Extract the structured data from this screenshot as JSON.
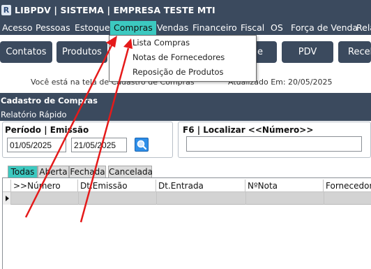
{
  "window": {
    "logo_letter": "R",
    "title": "LIBPDV | SISTEMA | EMPRESA TESTE MTI"
  },
  "menubar": {
    "items": [
      "Acesso",
      "Pessoas",
      "Estoque",
      "Compras",
      "Vendas",
      "Financeiro",
      "Fiscal",
      "OS",
      "Força de Venda",
      "Rela"
    ],
    "active": "Compras"
  },
  "dropdown": {
    "items": [
      "Lista Compras",
      "Notas de Fornecedores",
      "Reposição de Produtos"
    ]
  },
  "toolbar": {
    "buttons": [
      "Contatos",
      "Produtos",
      "e",
      "PDV",
      "Receb"
    ]
  },
  "status": {
    "screen_text": "Você está na tela de Cadastro de Compras",
    "updated_text": "Atualizado Em: 20/05/2025"
  },
  "form": {
    "title": "Cadastro de Compras",
    "subtitle": "Relatório Rápido"
  },
  "filters": {
    "period_label": "Período | Emissão",
    "date_from": "01/05/2025",
    "date_to": "21/05/2025",
    "locate_label": "F6 | Localizar <<Número>>",
    "locate_value": ""
  },
  "tabs": {
    "items": [
      "Todas",
      "Aberta",
      "Fechada",
      "Cancelada"
    ],
    "active": "Todas"
  },
  "grid": {
    "columns": [
      ">>Número",
      "Dt.Emissão",
      "Dt.Entrada",
      "NºNota",
      "Fornecedor"
    ]
  },
  "colors": {
    "bar": "#3b4a5e",
    "accent": "#3cc9c0",
    "annotation": "#e51a1a",
    "search_button": "#2e8ee8"
  },
  "icons": {
    "search_button": "magnifier-icon",
    "row_indicator": "triangle-right-icon"
  }
}
